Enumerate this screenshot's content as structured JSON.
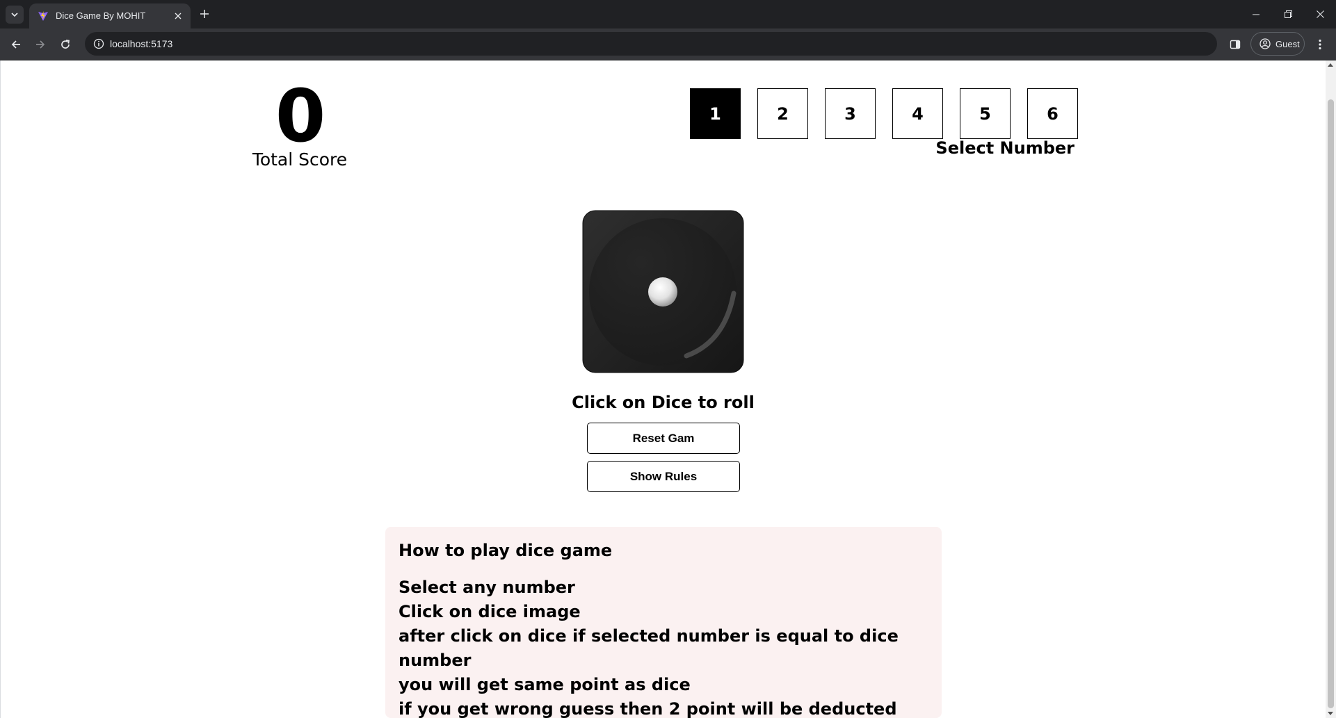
{
  "browser": {
    "tab_title": "Dice Game By MOHIT",
    "url": "localhost:5173",
    "profile_label": "Guest"
  },
  "game": {
    "total_score": "0",
    "total_score_label": "Total Score",
    "numbers": [
      "1",
      "2",
      "3",
      "4",
      "5",
      "6"
    ],
    "selected_number": "1",
    "select_number_label": "Select Number",
    "dice_face_value": 1,
    "roll_hint": "Click on Dice to roll",
    "reset_button_label": "Reset Gam",
    "show_rules_button_label": "Show Rules"
  },
  "rules": {
    "title": "How to play dice game",
    "lines": [
      "Select any number",
      "Click on dice image",
      "after click on dice if selected number is equal to dice number",
      "you will get same point as dice",
      "if you get wrong guess then 2 point will be deducted"
    ]
  },
  "colors": {
    "chrome_dark": "#202124",
    "chrome_tab": "#35363a",
    "selected_box": "#000000",
    "rules_background": "#fbf1f1"
  }
}
